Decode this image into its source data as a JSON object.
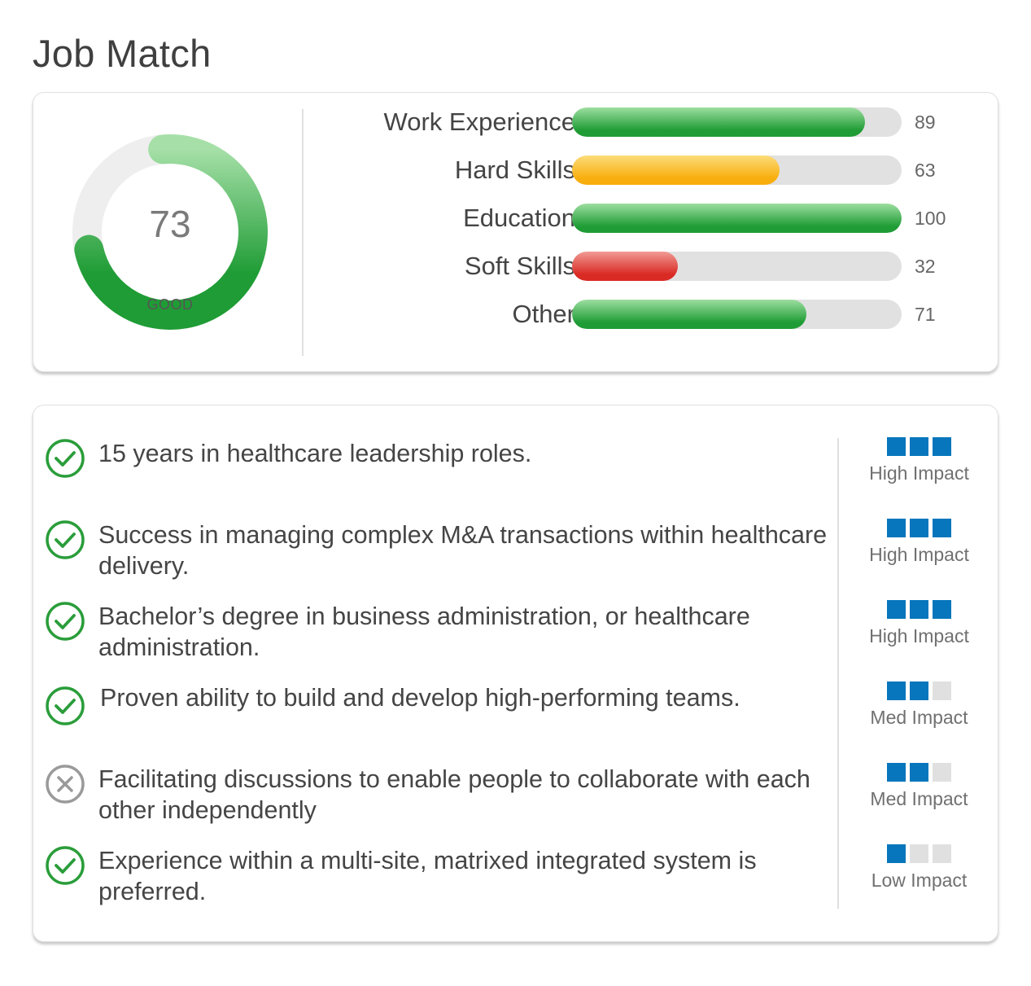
{
  "page": {
    "title": "Job Match"
  },
  "score": {
    "value": "73",
    "rating": "GOOD",
    "gauge_fraction": 0.73,
    "colors": {
      "track": "#efeeef",
      "fill_start": "#a6e0a8",
      "fill_end": "#1f9c35"
    }
  },
  "categories": [
    {
      "label": "Work Experience",
      "value": "89",
      "percent": 89,
      "color": "green"
    },
    {
      "label": "Hard Skills",
      "value": "63",
      "percent": 63,
      "color": "yellow"
    },
    {
      "label": "Education",
      "value": "100",
      "percent": 100,
      "color": "green"
    },
    {
      "label": "Soft Skills",
      "value": "32",
      "percent": 32,
      "color": "red"
    },
    {
      "label": "Other",
      "value": "71",
      "percent": 71,
      "color": "green"
    }
  ],
  "bar_colors": {
    "green": [
      "#9ddea0",
      "#1f9c35"
    ],
    "yellow": [
      "#fcdc7a",
      "#f8ae0c"
    ],
    "red": [
      "#f19a94",
      "#da2a24"
    ]
  },
  "requirements": [
    {
      "text": "15 years in healthcare leadership roles.",
      "status": "met",
      "impact": "High Impact",
      "impact_level": 3
    },
    {
      "text": "Success in managing complex M&A transactions within healthcare delivery.",
      "status": "met",
      "impact": "High Impact",
      "impact_level": 3
    },
    {
      "text": "Bachelor’s degree in business administration, or healthcare administration.",
      "status": "met",
      "impact": "High Impact",
      "impact_level": 3
    },
    {
      "text": "Proven ability to build and develop high-performing teams.",
      "status": "met",
      "impact": "Med Impact",
      "impact_level": 2
    },
    {
      "text": "Facilitating discussions to enable people to collaborate with each other independently",
      "status": "unmet",
      "impact": "Med Impact",
      "impact_level": 2
    },
    {
      "text": "Experience within a multi-site, matrixed integrated system is preferred.",
      "status": "met",
      "impact": "Low Impact",
      "impact_level": 1
    }
  ],
  "status_colors": {
    "met": "#2a9d3a",
    "unmet": "#9a9a9a"
  },
  "impact_colors": {
    "on": "#0776bc",
    "off": "#e1e0e1"
  }
}
